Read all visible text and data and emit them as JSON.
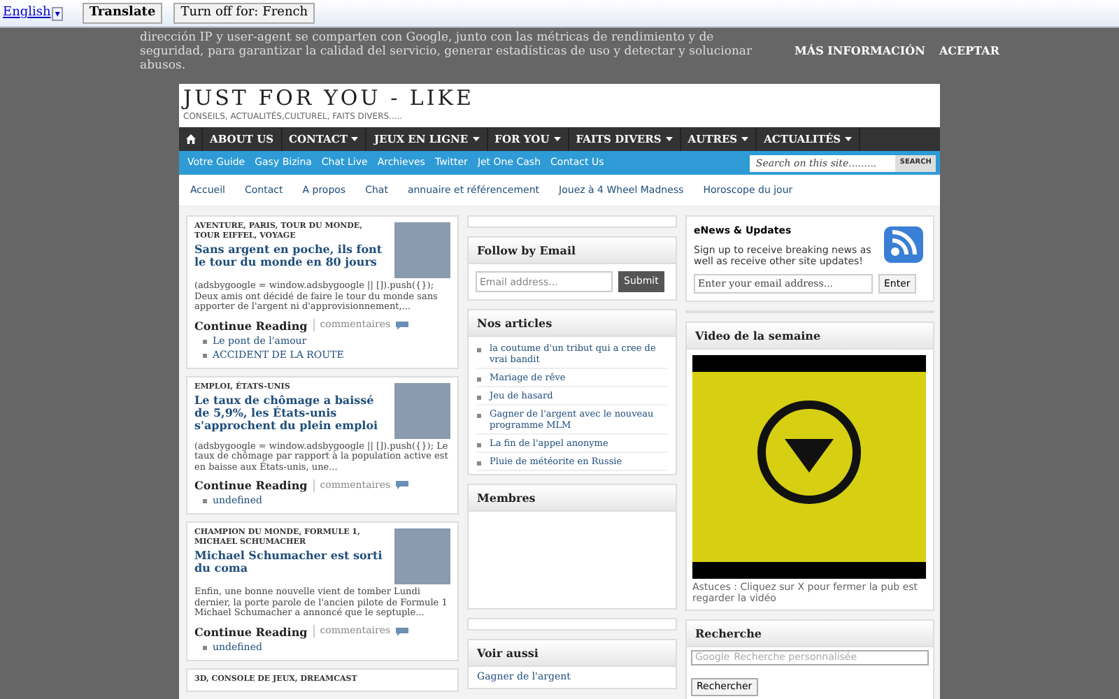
{
  "translate_bar": {
    "language": "English",
    "language_caret": "▾",
    "translate_button": "Translate",
    "turn_off_button": "Turn off for: French"
  },
  "cookie_notice": {
    "text": "dirección IP y user-agent se comparten con Google, junto con las métricas de rendimiento y de seguridad, para garantizar la calidad del servicio, generar estadísticas de uso y detectar y solucionar abusos.",
    "buttons": [
      "MÁS INFORMACIÓN",
      "ACEPTAR"
    ]
  },
  "header": {
    "title": "JUST FOR YOU - LIKE",
    "tagline": "CONSEILS, ACTUALITÉS,CULTUREL, FAITS DIVERS....."
  },
  "main_nav": [
    {
      "label": "ABOUT US",
      "dropdown": false
    },
    {
      "label": "CONTACT",
      "dropdown": true
    },
    {
      "label": "JEUX EN LIGNE",
      "dropdown": true
    },
    {
      "label": "FOR YOU",
      "dropdown": true
    },
    {
      "label": "FAITS DIVERS",
      "dropdown": true
    },
    {
      "label": "AUTRES",
      "dropdown": true
    },
    {
      "label": "ACTUALITÉS",
      "dropdown": true
    }
  ],
  "sub_nav": [
    "Votre Guide",
    "Gasy Bizina",
    "Chat Live",
    "Archieves",
    "Twitter",
    "Jet One Cash",
    "Contact Us"
  ],
  "site_search": {
    "placeholder": "Search on this site.........",
    "button": "SEARCH"
  },
  "page_links": [
    "Accueil",
    "Contact",
    "A propos",
    "Chat",
    "annuaire et référencement",
    "Jouez à 4 Wheel Madness",
    "Horoscope du jour"
  ],
  "articles": [
    {
      "categories": "AVENTURE, PARIS, TOUR DU MONDE, TOUR EIFFEL, VOYAGE",
      "title": "Sans argent en poche, ils font le tour du monde en 80 jours",
      "excerpt": "(adsbygoogle = window.adsbygoogle || []).push({}); Deux amis ont décidé de faire le tour du monde sans apporter de l'argent ni d'approvisionnement,...",
      "continue": "Continue Reading",
      "comments": "commentaires",
      "related": [
        "Le pont de l'amour",
        "ACCIDENT DE LA ROUTE"
      ]
    },
    {
      "categories": "EMPLOI, ÉTATS-UNIS",
      "title": "Le taux de chômage a baissé de 5,9%, les États-unis s'approchent du plein emploi",
      "excerpt": "(adsbygoogle = window.adsbygoogle || []).push({}); Le taux de chômage par rapport à la population active est en baisse aux États-unis, une...",
      "continue": "Continue Reading",
      "comments": "commentaires",
      "related": [
        "undefined"
      ]
    },
    {
      "categories": "CHAMPION DU MONDE, FORMULE 1, MICHAEL SCHUMACHER",
      "title": "Michael Schumacher est sorti du coma",
      "excerpt": "Enfin, une bonne nouvelle vient de tomber Lundi dernier, la porte parole de l'ancien pilote de Formule 1 Michael Schumacher a annoncé que le septuple...",
      "continue": "Continue Reading",
      "comments": "commentaires",
      "related": [
        "undefined"
      ]
    },
    {
      "categories": "3D, CONSOLE DE JEUX, DREAMCAST"
    }
  ],
  "follow_by_email": {
    "title": "Follow by Email",
    "placeholder": "Email address...",
    "button": "Submit"
  },
  "nos_articles": {
    "title": "Nos articles",
    "items": [
      "la coutume d'un tribut qui a cree de vrai bandit",
      "Mariage de rêve",
      "Jeu de hasard",
      "Gagner de l'argent avec le nouveau programme MLM",
      "La fin de l'appel anonyme",
      "Pluie de météorite en Russie"
    ]
  },
  "membres": {
    "title": "Membres"
  },
  "voir_aussi": {
    "title": "Voir aussi",
    "items": [
      "Gagner de l'argent"
    ]
  },
  "enews": {
    "title": "eNews & Updates",
    "text": "Sign up to receive breaking news as well as receive other site updates!",
    "placeholder": "Enter your email address...",
    "button": "Enter"
  },
  "video": {
    "title": "Video de la semaine",
    "caption": "Astuces : Cliquez sur X pour fermer la pub est regarder la vidéo"
  },
  "recherche": {
    "title": "Recherche",
    "brand": "Google",
    "placeholder": "Recherche personnalisée",
    "button": "Rechercher"
  }
}
